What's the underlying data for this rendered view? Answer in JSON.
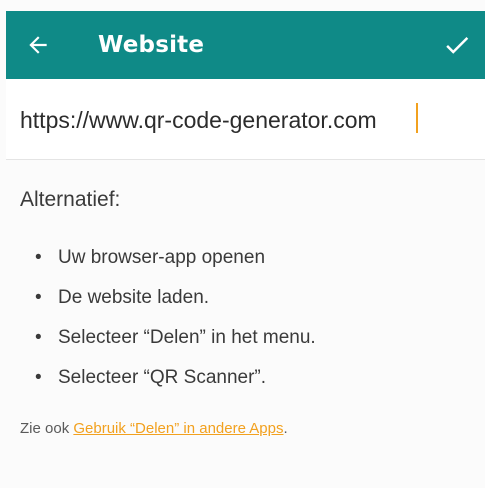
{
  "app": {
    "title": "Website"
  },
  "colors": {
    "toolbar": "#0f8a87",
    "accent": "#f2a11f",
    "text": "#3a3a3a"
  },
  "icons": {
    "back": "arrow-left-icon",
    "confirm": "checkmark-icon"
  },
  "url_field": {
    "value": "https://www.qr-code-generator.com"
  },
  "alternative": {
    "heading": "Alternatief:",
    "bullet_glyph": "•",
    "items": [
      "Uw browser-app openen",
      "De website laden.",
      "Selecteer “Delen” in het menu.",
      "Selecteer “QR Scanner”."
    ]
  },
  "see_also": {
    "prefix": "Zie ook ",
    "link": "Gebruik “Delen” in andere Apps",
    "suffix": "."
  }
}
